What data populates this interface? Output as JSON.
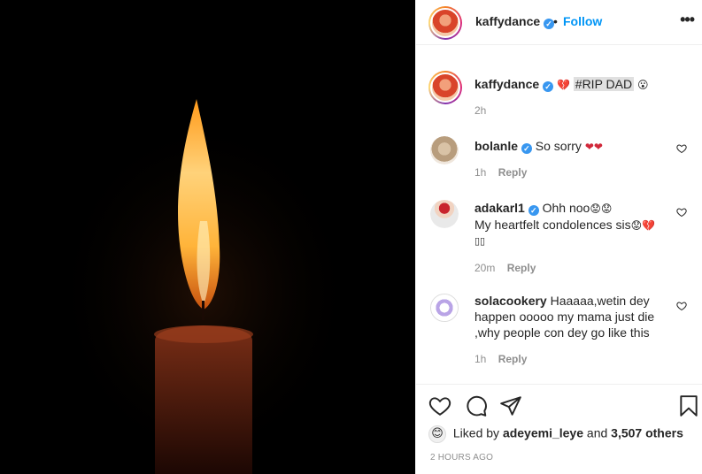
{
  "post": {
    "author": "kaffydance",
    "follow_label": "Follow",
    "separator": "•",
    "more_label": "•••"
  },
  "caption": {
    "username": "kaffydance",
    "emoji_before": "💔",
    "hashtag": "#RIP DAD",
    "emoji_after": "😮",
    "time": "2h"
  },
  "comments": [
    {
      "username": "bolanle",
      "text": "So sorry",
      "emoji": "❤❤",
      "time": "1h",
      "reply_label": "Reply"
    },
    {
      "username": "adakarl1",
      "text": "Ohh noo",
      "emoji": "😟😟",
      "line2": "My heartfelt condolences sis",
      "line2_emoji": "😟💔",
      "line3": "▯▯",
      "time": "20m",
      "reply_label": "Reply"
    },
    {
      "username": "solacookery",
      "text": "Haaaaa,wetin dey happen ooooo my mama just die ,why people con dey go like this",
      "time": "1h",
      "reply_label": "Reply"
    }
  ],
  "likes": {
    "prefix": "Liked by",
    "user": "adeyemi_leye",
    "middle": "and",
    "count": "3,507 others",
    "avatar_emoji": "😊"
  },
  "timestamp": "2 HOURS AGO",
  "colors": {
    "accent": "#0095f6",
    "verified": "#3897f0",
    "muted": "#8e8e8e",
    "heart": "#d1283a"
  }
}
